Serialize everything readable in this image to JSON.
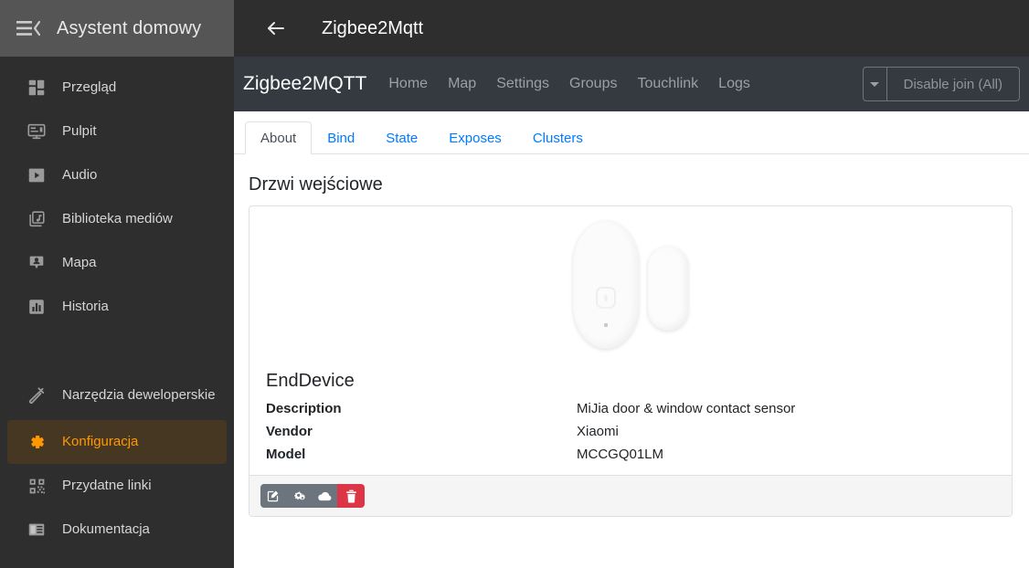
{
  "sidebar": {
    "title": "Asystent domowy",
    "toggle_icon": "menu-open-icon",
    "items": [
      {
        "label": "Przegląd",
        "icon": "dashboard-grid-icon",
        "active": false
      },
      {
        "label": "Pulpit",
        "icon": "desktop-icon",
        "active": false
      },
      {
        "label": "Audio",
        "icon": "play-box-icon",
        "active": false
      },
      {
        "label": "Biblioteka mediów",
        "icon": "media-library-icon",
        "active": false
      },
      {
        "label": "Mapa",
        "icon": "map-marker-icon",
        "active": false
      },
      {
        "label": "Historia",
        "icon": "chart-bar-icon",
        "active": false
      },
      {
        "label": "Narzędzia deweloperskie",
        "icon": "hammer-icon",
        "active": false
      },
      {
        "label": "Konfiguracja",
        "icon": "gear-icon",
        "active": true
      },
      {
        "label": "Przydatne linki",
        "icon": "qr-code-icon",
        "active": false
      },
      {
        "label": "Dokumentacja",
        "icon": "book-icon",
        "active": false
      }
    ],
    "active_color": "#ff9800",
    "active_bg": "#463722",
    "bg": "#2e2e2e",
    "header_bg": "#555555"
  },
  "topbar": {
    "back_icon": "arrow-left-icon",
    "title": "Zigbee2Mqtt"
  },
  "navbar": {
    "brand": "Zigbee2MQTT",
    "links": [
      "Home",
      "Map",
      "Settings",
      "Groups",
      "Touchlink",
      "Logs"
    ],
    "join_button": "Disable join (All)",
    "caret_icon": "caret-down-icon",
    "bg": "#343a40"
  },
  "tabs": [
    {
      "label": "About",
      "active": true
    },
    {
      "label": "Bind",
      "active": false
    },
    {
      "label": "State",
      "active": false
    },
    {
      "label": "Exposes",
      "active": false
    },
    {
      "label": "Clusters",
      "active": false
    }
  ],
  "page": {
    "title": "Drzwi wejściowe"
  },
  "device": {
    "image_alt": "xiaomi-door-window-sensor-image",
    "type": "EndDevice",
    "rows": [
      {
        "key": "Description",
        "value": "MiJia door & window contact sensor"
      },
      {
        "key": "Vendor",
        "value": "Xiaomi"
      },
      {
        "key": "Model",
        "value": "MCCGQ01LM"
      }
    ]
  },
  "toolbar": {
    "buttons": [
      {
        "name": "edit-button",
        "icon": "pencil-square-icon",
        "variant": "secondary"
      },
      {
        "name": "settings-button",
        "icon": "gears-icon",
        "variant": "secondary"
      },
      {
        "name": "ota-button",
        "icon": "cloud-icon",
        "variant": "secondary"
      },
      {
        "name": "delete-button",
        "icon": "trash-icon",
        "variant": "danger"
      }
    ],
    "secondary_color": "#6c757d",
    "danger_color": "#dc3545"
  }
}
